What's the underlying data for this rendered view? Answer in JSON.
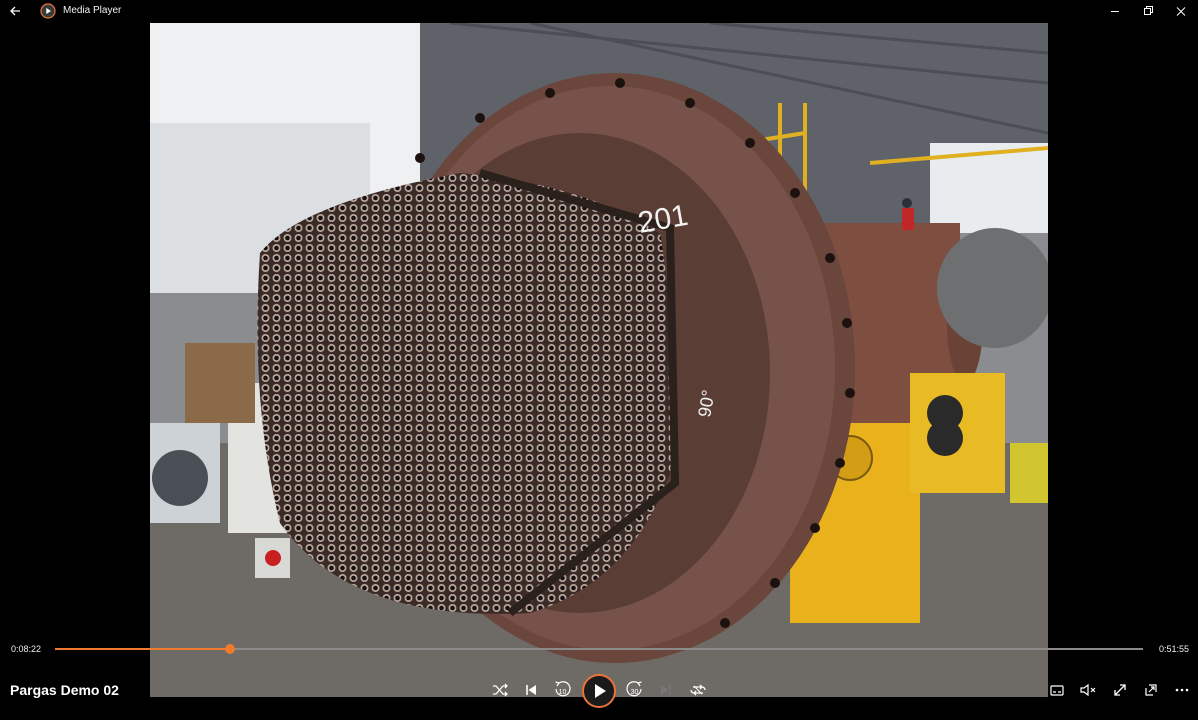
{
  "window": {
    "title": "Media Player",
    "controls": [
      "minimize-icon",
      "maximize-icon",
      "close-icon"
    ]
  },
  "player": {
    "media_title": "Pargas Demo 02",
    "current_time": "0:08:22",
    "total_time": "0:51:55",
    "progress_fraction": 0.161,
    "skip_back_seconds": "10",
    "skip_forward_seconds": "30",
    "state": "paused"
  },
  "controls": {
    "left_group": [
      "shuffle-icon",
      "previous-icon",
      "skip-back-icon",
      "play-icon",
      "skip-forward-icon",
      "next-icon",
      "repeat-icon"
    ],
    "right_group": [
      "subtitles-icon",
      "volume-mute-icon",
      "fullscreen-icon",
      "mini-player-icon",
      "more-options-icon"
    ]
  },
  "colors": {
    "accent": "#ef7b2e",
    "background": "#000000",
    "track": "#8a8a8a"
  }
}
